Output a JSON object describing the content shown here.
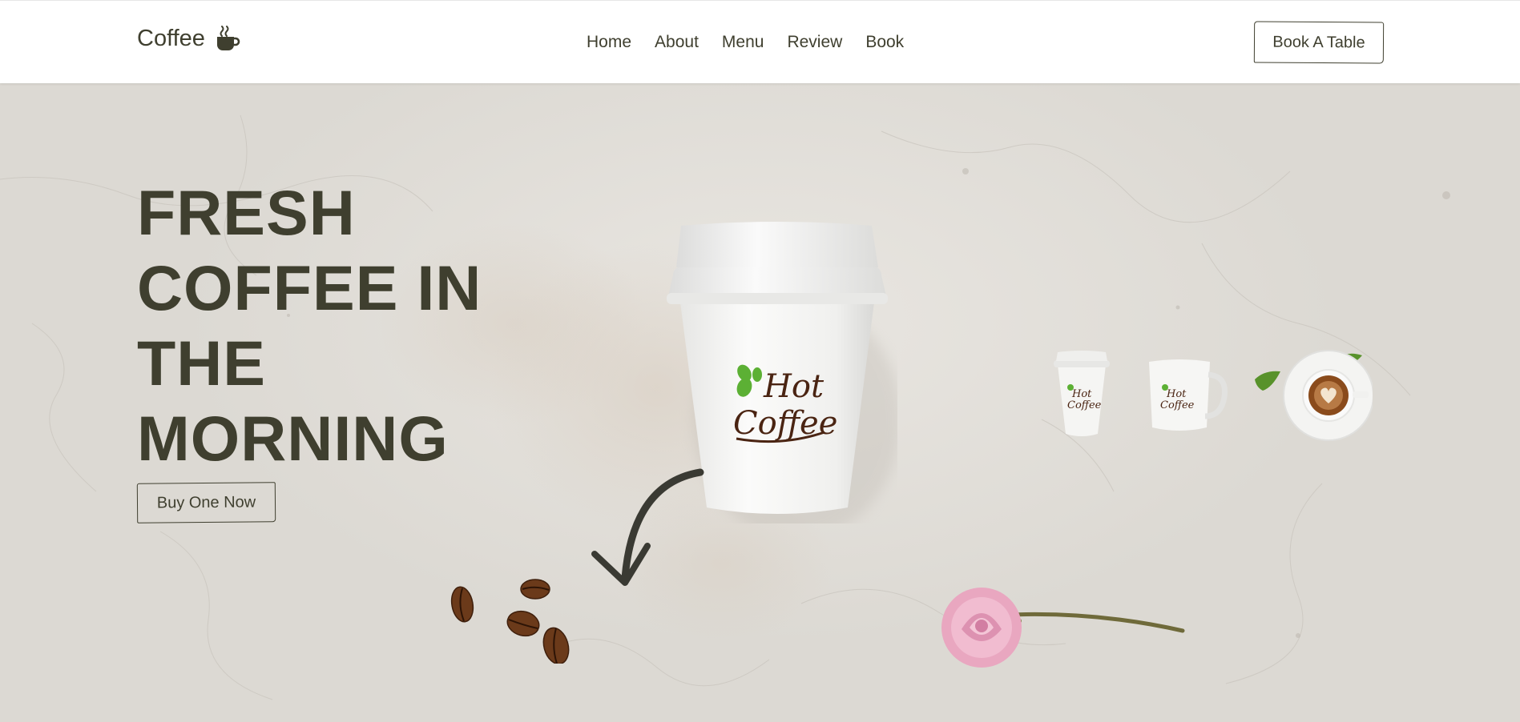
{
  "brand": {
    "name": "Coffee",
    "icon": "coffee-cup-icon"
  },
  "nav": {
    "items": [
      {
        "label": "Home"
      },
      {
        "label": "About"
      },
      {
        "label": "Menu"
      },
      {
        "label": "Review"
      },
      {
        "label": "Book"
      }
    ],
    "cta_label": "Book A Table"
  },
  "hero": {
    "headline_lines": [
      "FRESH",
      "COFFEE IN",
      "THE",
      "MORNING"
    ],
    "button_label": "Buy One Now",
    "product_logo": {
      "line1": "Hot",
      "line2": "Coffee"
    },
    "thumbnails": [
      "paper-cup",
      "mug",
      "latte"
    ]
  },
  "colors": {
    "text": "#3f3f2f",
    "background": "#e3e0da",
    "logo_brown": "#4a2412",
    "leaf_green": "#5cb034"
  }
}
